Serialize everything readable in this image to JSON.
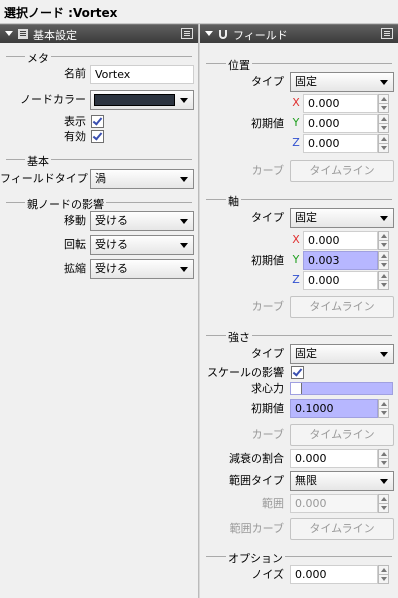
{
  "title": "選択ノード :Vortex",
  "left_panel": {
    "header": "基本設定",
    "meta_section": "メタ",
    "name_label": "名前",
    "name_value": "Vortex",
    "node_color_label": "ノードカラー",
    "node_color": "#2c3440",
    "visible_label": "表示",
    "visible_checked": true,
    "enabled_label": "有効",
    "enabled_checked": true,
    "basic_section": "基本",
    "field_type_label": "フィールドタイプ",
    "field_type_value": "渦",
    "parent_section": "親ノードの影響",
    "move_label": "移動",
    "move_value": "受ける",
    "rotate_label": "回転",
    "rotate_value": "受ける",
    "scale_label": "拡縮",
    "scale_value": "受ける"
  },
  "right_panel": {
    "header": "フィールド",
    "position": {
      "section": "位置",
      "type_label": "タイプ",
      "type_value": "固定",
      "initial_label": "初期値",
      "x_label": "X",
      "x_value": "0.000",
      "y_label": "Y",
      "y_value": "0.000",
      "z_label": "Z",
      "z_value": "0.000",
      "curve_label": "カーブ",
      "timeline_button": "タイムライン"
    },
    "axis": {
      "section": "軸",
      "type_label": "タイプ",
      "type_value": "固定",
      "initial_label": "初期値",
      "x_label": "X",
      "x_value": "0.000",
      "y_label": "Y",
      "y_value": "0.003",
      "z_label": "Z",
      "z_value": "0.000",
      "curve_label": "カーブ",
      "timeline_button": "タイムライン"
    },
    "strength": {
      "section": "強さ",
      "type_label": "タイプ",
      "type_value": "固定",
      "scale_influence_label": "スケールの影響",
      "scale_influence_checked": true,
      "centripetal_label": "求心力",
      "centripetal_checked": false,
      "initial_label": "初期値",
      "initial_value": "0.1000",
      "curve_label": "カーブ",
      "timeline_button": "タイムライン",
      "decay_label": "減衰の割合",
      "decay_value": "0.000",
      "range_type_label": "範囲タイプ",
      "range_type_value": "無限",
      "range_label": "範囲",
      "range_value": "0.000",
      "range_curve_label": "範囲カーブ",
      "range_timeline_button": "タイムライン"
    },
    "options": {
      "section": "オプション",
      "noise_label": "ノイズ",
      "noise_value": "0.000"
    }
  },
  "colors": {
    "x_axis": "#e03030",
    "y_axis": "#20a020",
    "z_axis": "#3050d0",
    "highlight": "#b7b7ff"
  }
}
